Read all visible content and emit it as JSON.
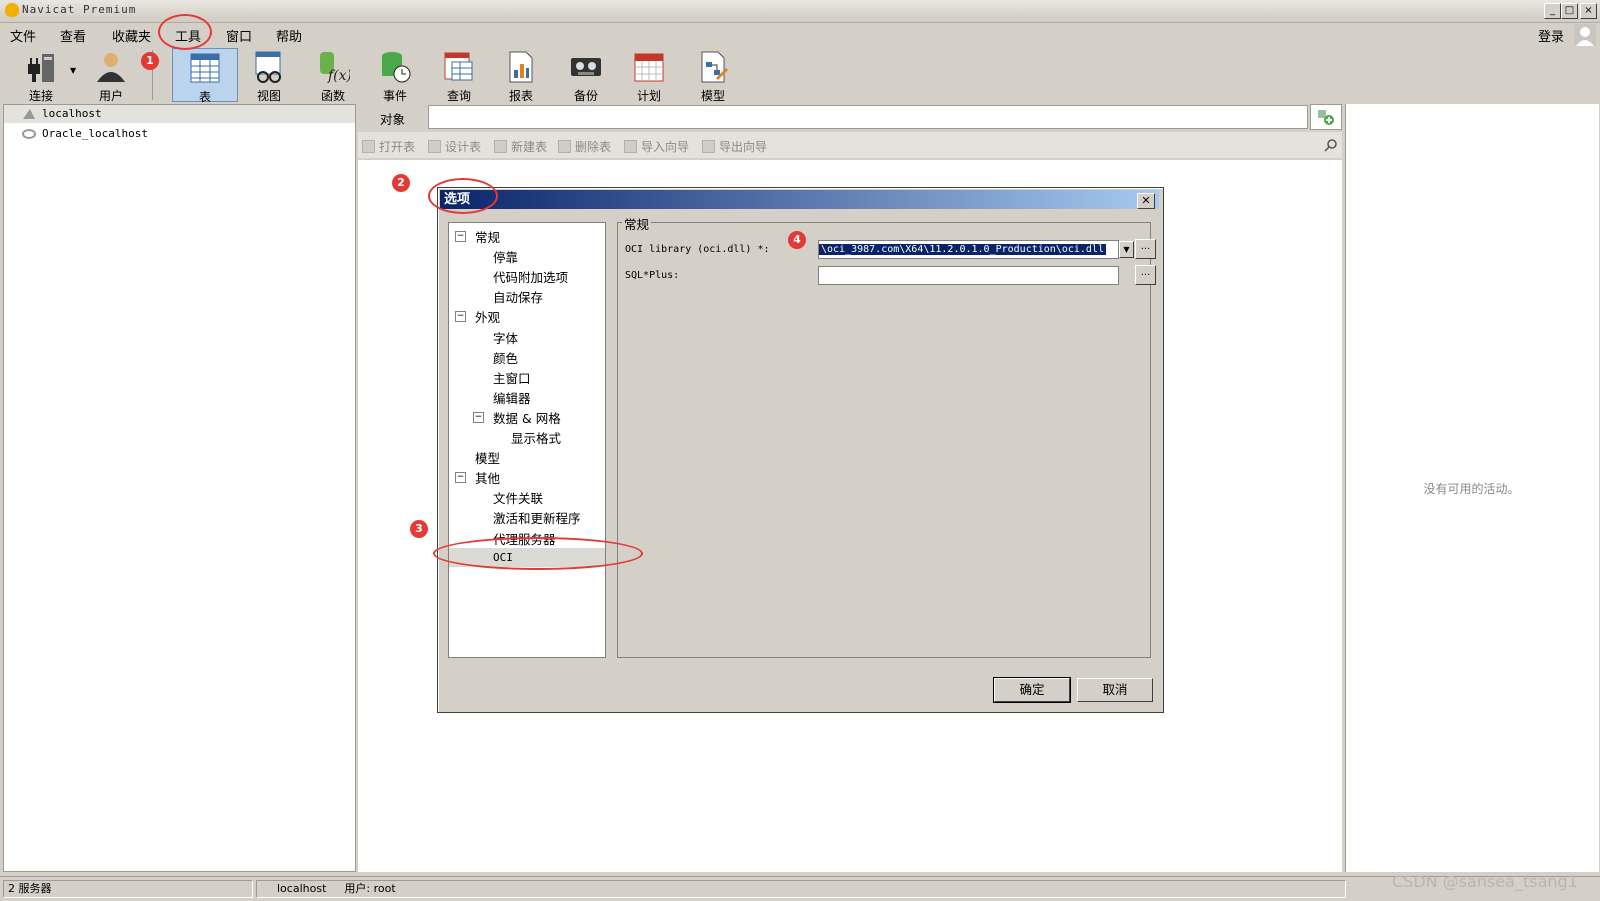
{
  "window": {
    "title": "Navicat Premium",
    "login_label": "登录"
  },
  "menubar": [
    "文件",
    "查看",
    "收藏夹",
    "工具",
    "窗口",
    "帮助"
  ],
  "toolbar": [
    {
      "label": "连接",
      "icon": "plug-icon"
    },
    {
      "label": "用户",
      "icon": "user-icon"
    },
    {
      "label": "表",
      "icon": "table-icon"
    },
    {
      "label": "视图",
      "icon": "view-icon"
    },
    {
      "label": "函数",
      "icon": "function-icon"
    },
    {
      "label": "事件",
      "icon": "event-icon"
    },
    {
      "label": "查询",
      "icon": "query-icon"
    },
    {
      "label": "报表",
      "icon": "report-icon"
    },
    {
      "label": "备份",
      "icon": "backup-icon"
    },
    {
      "label": "计划",
      "icon": "schedule-icon"
    },
    {
      "label": "模型",
      "icon": "model-icon"
    }
  ],
  "connections": [
    "localhost",
    "Oracle_localhost"
  ],
  "object_label": "对象",
  "actions": [
    "打开表",
    "设计表",
    "新建表",
    "删除表",
    "导入向导",
    "导出向导"
  ],
  "right_pane": {
    "empty_text": "没有可用的活动。"
  },
  "statusbar": {
    "servers": "2 服务器",
    "connection": "localhost",
    "user": "用户: root"
  },
  "dialog": {
    "title": "选项",
    "tree": [
      {
        "label": "常规",
        "level": 0,
        "expander": "⊟"
      },
      {
        "label": "停靠",
        "level": 1
      },
      {
        "label": "代码附加选项",
        "level": 1
      },
      {
        "label": "自动保存",
        "level": 1
      },
      {
        "label": "外观",
        "level": 0,
        "expander": "⊟"
      },
      {
        "label": "字体",
        "level": 1
      },
      {
        "label": "颜色",
        "level": 1
      },
      {
        "label": "主窗口",
        "level": 1
      },
      {
        "label": "编辑器",
        "level": 1
      },
      {
        "label": "数据 & 网格",
        "level": 1,
        "expander": "⊟"
      },
      {
        "label": "显示格式",
        "level": 2
      },
      {
        "label": "模型",
        "level": 0
      },
      {
        "label": "其他",
        "level": 0,
        "expander": "⊟"
      },
      {
        "label": "文件关联",
        "level": 1
      },
      {
        "label": "激活和更新程序",
        "level": 1
      },
      {
        "label": "代理服务器",
        "level": 1
      },
      {
        "label": "OCI",
        "level": 1,
        "selected": true
      }
    ],
    "section_title": "常规",
    "oci_label": "OCI library (oci.dll) *:",
    "oci_value": "\\oci_3987.com\\X64\\11.2.0.1.0_Production\\oci.dll",
    "sqlplus_label": "SQL*Plus:",
    "sqlplus_value": "",
    "browse_label": "...",
    "ok_label": "确定",
    "cancel_label": "取消"
  },
  "annotations": [
    "1",
    "2",
    "3",
    "4"
  ],
  "watermark": "CSDN @sansea_tsang1"
}
